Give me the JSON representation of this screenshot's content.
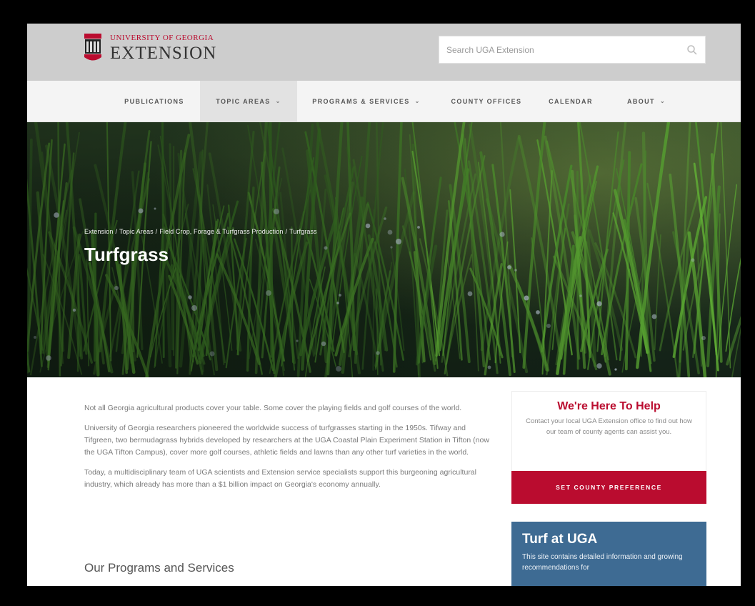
{
  "header": {
    "university": "UNIVERSITY OF GEORGIA",
    "unit": "EXTENSION",
    "search_placeholder": "Search UGA Extension"
  },
  "nav": {
    "items": [
      {
        "label": "PUBLICATIONS",
        "has_dropdown": false,
        "active": false
      },
      {
        "label": "TOPIC AREAS",
        "has_dropdown": true,
        "active": true
      },
      {
        "label": "PROGRAMS & SERVICES",
        "has_dropdown": true,
        "active": false
      },
      {
        "label": "COUNTY OFFICES",
        "has_dropdown": false,
        "active": false
      },
      {
        "label": "CALENDAR",
        "has_dropdown": false,
        "active": false
      },
      {
        "label": "ABOUT",
        "has_dropdown": true,
        "active": false
      }
    ]
  },
  "hero": {
    "breadcrumb": [
      "Extension",
      "Topic Areas",
      "Field Crop, Forage & Turfgrass Production",
      "Turfgrass"
    ],
    "title": "Turfgrass"
  },
  "main": {
    "paragraphs": [
      "Not all Georgia agricultural products cover your table. Some cover the playing fields and golf courses of the world.",
      "University of Georgia researchers pioneered the worldwide success of turfgrasses starting in the 1950s. Tifway and Tifgreen, two bermudagrass hybrids developed by researchers at the UGA Coastal Plain Experiment Station in Tifton (now the UGA Tifton Campus), cover more golf courses, athletic fields and lawns than any other turf varieties in the world.",
      "Today, a multidisciplinary team of UGA scientists and Extension service specialists support this burgeoning agricultural industry, which already has more than a $1 billion impact on Georgia's economy annually."
    ],
    "section_heading": "Our Programs and Services"
  },
  "sidebar": {
    "help_title": "We're Here To Help",
    "help_text": "Contact your local UGA Extension office to find out how our team of county agents can assist you.",
    "county_button": "SET COUNTY PREFERENCE",
    "turf_title": "Turf at UGA",
    "turf_text": "This site contains detailed information and growing recommendations for"
  },
  "colors": {
    "brand_red": "#ba0c2f",
    "turf_blue": "#3e6b93",
    "header_gray": "#cdcdcd"
  }
}
